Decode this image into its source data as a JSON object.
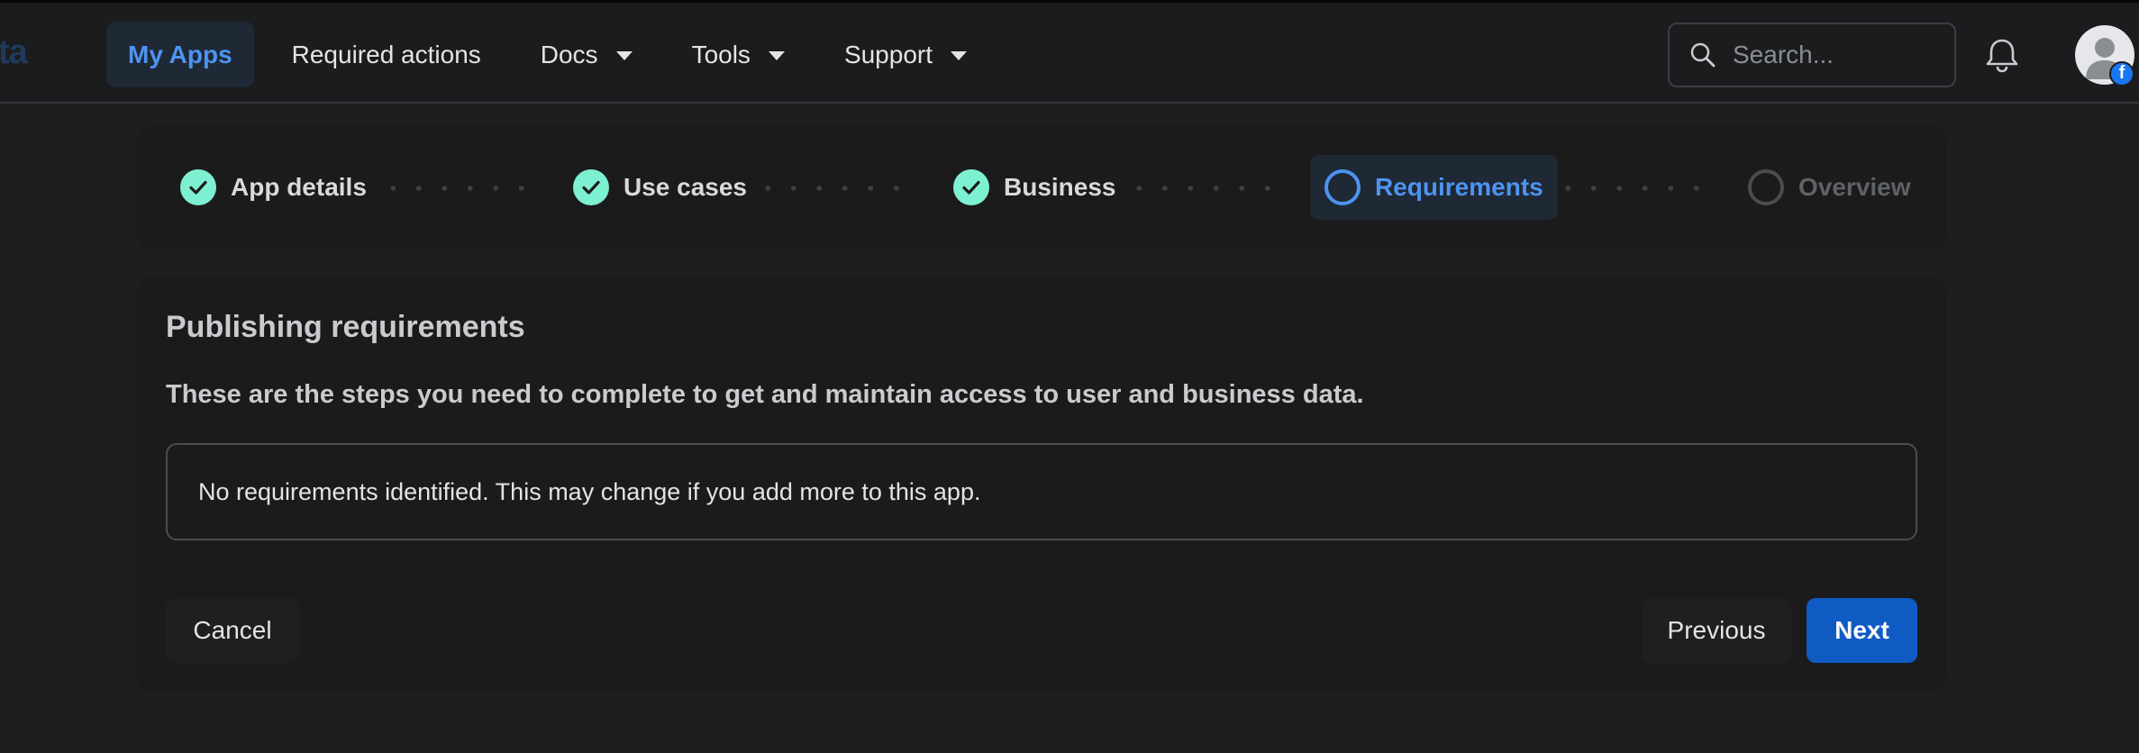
{
  "header": {
    "logo_fragment": "ta",
    "nav": [
      {
        "label": "My Apps",
        "active": true,
        "dropdown": false
      },
      {
        "label": "Required actions",
        "active": false,
        "dropdown": false
      },
      {
        "label": "Docs",
        "active": false,
        "dropdown": true
      },
      {
        "label": "Tools",
        "active": false,
        "dropdown": true
      },
      {
        "label": "Support",
        "active": false,
        "dropdown": true
      }
    ],
    "search": {
      "placeholder": "Search...",
      "value": ""
    },
    "icons": [
      "search-icon",
      "bell-icon",
      "avatar",
      "facebook-badge-icon"
    ],
    "badge_letter": "f"
  },
  "stepper": {
    "steps": [
      {
        "label": "App details",
        "state": "complete"
      },
      {
        "label": "Use cases",
        "state": "complete"
      },
      {
        "label": "Business",
        "state": "complete"
      },
      {
        "label": "Requirements",
        "state": "current"
      },
      {
        "label": "Overview",
        "state": "pending"
      }
    ]
  },
  "card": {
    "title": "Publishing requirements",
    "subtitle": "These are the steps you need to complete to get and maintain access to user and business data.",
    "notice": "No requirements identified. This may change if you add more to this app."
  },
  "footer": {
    "cancel_label": "Cancel",
    "previous_label": "Previous",
    "next_label": "Next"
  },
  "colors": {
    "accent": "#4d94f0",
    "complete": "#7ef0d2",
    "primary_button": "#0f5bc4",
    "background": "#1c1e1f"
  }
}
